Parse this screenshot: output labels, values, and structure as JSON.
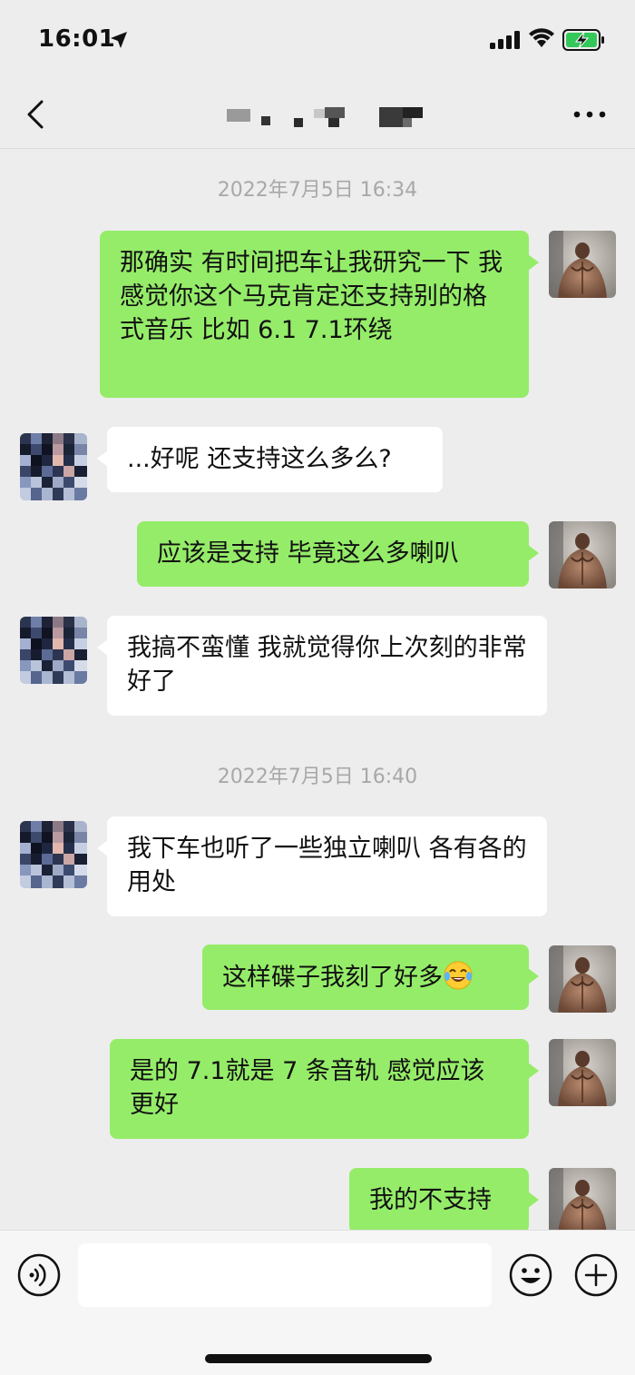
{
  "status_bar": {
    "time": "16:01",
    "icons": [
      "location-arrow-icon",
      "cellular-signal-icon",
      "wifi-icon",
      "battery-charging-icon"
    ]
  },
  "nav": {
    "back_icon": "chevron-left-icon",
    "title": "",
    "title_note_pixelated": true,
    "more_icon": "more-dots-icon"
  },
  "chat": {
    "timestamps": [
      "2022年7月5日 16:34",
      "2022年7月5日 16:40"
    ],
    "messages": [
      {
        "sender": "me",
        "text": "那确实   有时间把车让我研究一下  我感觉你这个马克肯定还支持别的格式音乐   比如 6.1  7.1环绕"
      },
      {
        "sender": "other",
        "text": "...好呢 还支持这么多么?"
      },
      {
        "sender": "me",
        "text": "应该是支持  毕竟这么多喇叭"
      },
      {
        "sender": "other",
        "text": "我搞不蛮懂 我就觉得你上次刻的非常好了"
      },
      {
        "sender": "other",
        "text": "我下车也听了一些独立喇叭 各有各的用处"
      },
      {
        "sender": "me",
        "text": "这样碟子我刻了好多",
        "emoji": "tears-of-joy-emoji"
      },
      {
        "sender": "me",
        "text": "是的   7.1就是 7 条音轨   感觉应该更好"
      },
      {
        "sender": "me",
        "text": "我的不支持"
      }
    ]
  },
  "input_bar": {
    "voice_icon": "voice-input-icon",
    "input_value": "",
    "emoji_icon": "emoji-icon",
    "plus_icon": "plus-icon"
  },
  "colors": {
    "background": "#ededed",
    "my_bubble": "#95ec69",
    "their_bubble": "#ffffff",
    "timestamp_text": "#a8a8a8"
  }
}
